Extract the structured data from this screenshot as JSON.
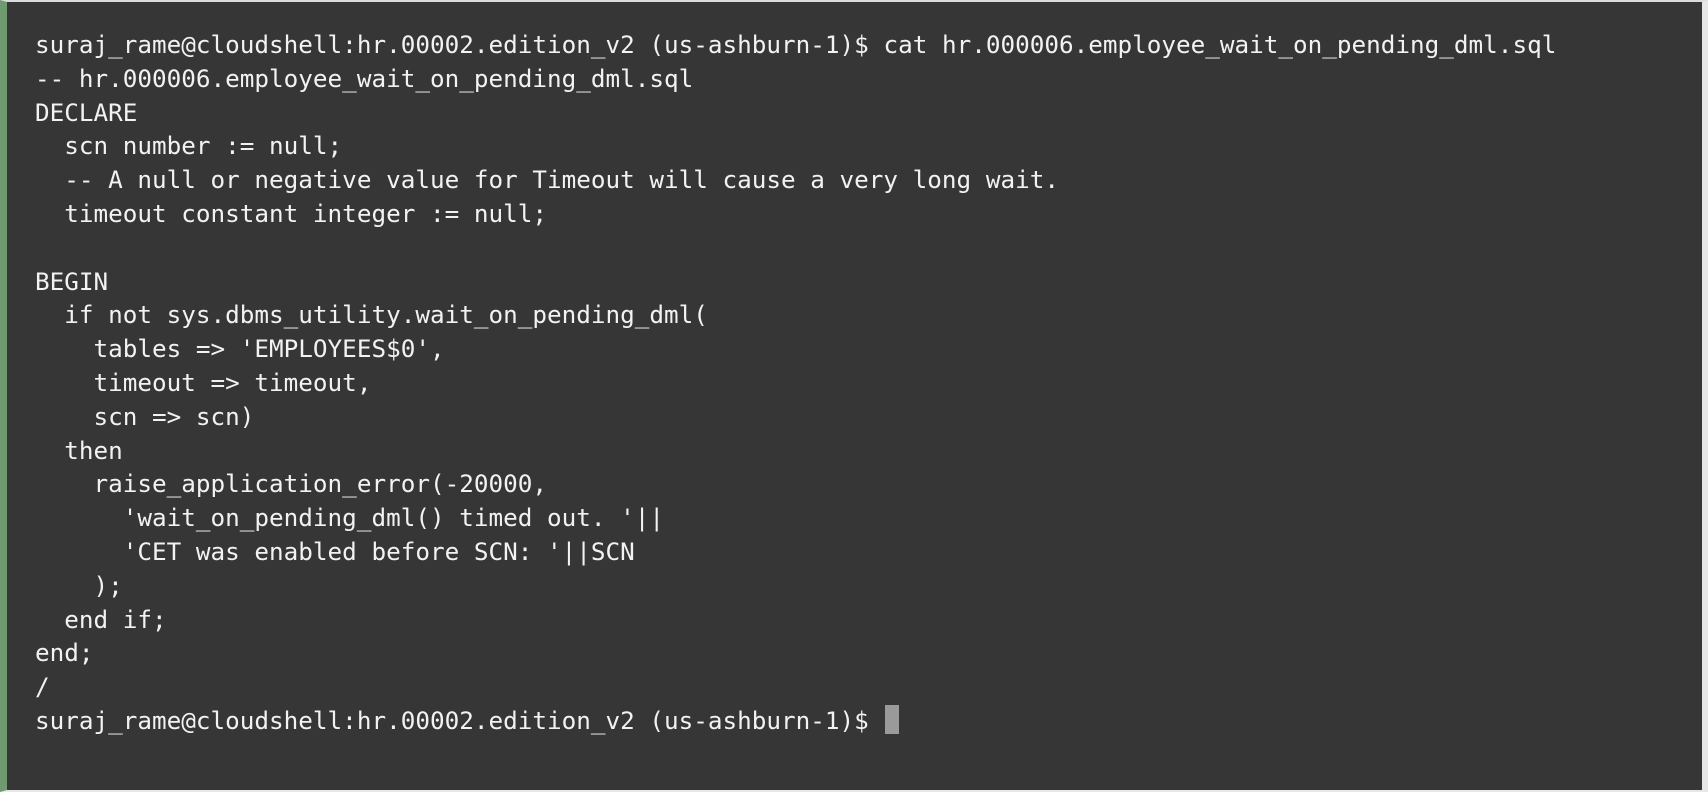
{
  "terminal": {
    "prompt": "suraj_rame@cloudshell:hr.00002.edition_v2 (us-ashburn-1)$",
    "command": "cat hr.000006.employee_wait_on_pending_dml.sql",
    "lines": [
      "-- hr.000006.employee_wait_on_pending_dml.sql",
      "DECLARE",
      "  scn number := null;",
      "  -- A null or negative value for Timeout will cause a very long wait.",
      "  timeout constant integer := null;",
      "",
      "BEGIN",
      "  if not sys.dbms_utility.wait_on_pending_dml(",
      "    tables => 'EMPLOYEES$0',",
      "    timeout => timeout,",
      "    scn => scn)",
      "  then",
      "    raise_application_error(-20000,",
      "      'wait_on_pending_dml() timed out. '||",
      "      'CET was enabled before SCN: '||SCN",
      "    );",
      "  end if;",
      "end;",
      "/"
    ],
    "final_prompt": "suraj_rame@cloudshell:hr.00002.edition_v2 (us-ashburn-1)$"
  }
}
